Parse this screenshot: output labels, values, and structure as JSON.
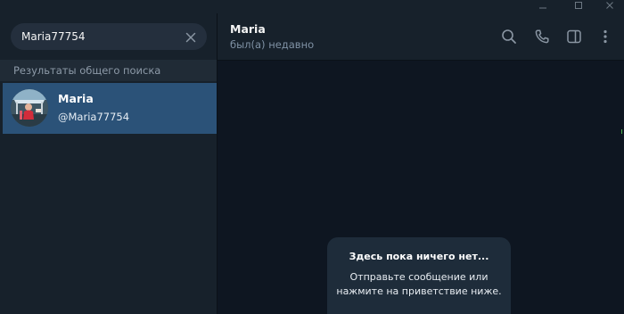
{
  "window": {
    "controls": [
      "minimize-icon",
      "maximize-icon",
      "close-icon"
    ]
  },
  "search": {
    "value": "Maria77754",
    "section_title": "Результаты общего поиска"
  },
  "results": [
    {
      "name": "Maria",
      "username": "@Maria77754",
      "selected": true
    }
  ],
  "chat": {
    "title": "Maria",
    "status": "был(а) недавно",
    "header_icons": [
      "search-icon",
      "phone-icon",
      "side-panel-icon",
      "more-vertical-icon"
    ],
    "empty_title": "Здесь пока ничего нет...",
    "empty_text": "Отправьте сообщение или\nнажмите на приветствие ниже."
  },
  "colors": {
    "background": "#0e1621",
    "panel": "#17212b",
    "selected_row": "#2b5278",
    "search_box": "#242f3d",
    "muted_text": "#7f91a4"
  }
}
